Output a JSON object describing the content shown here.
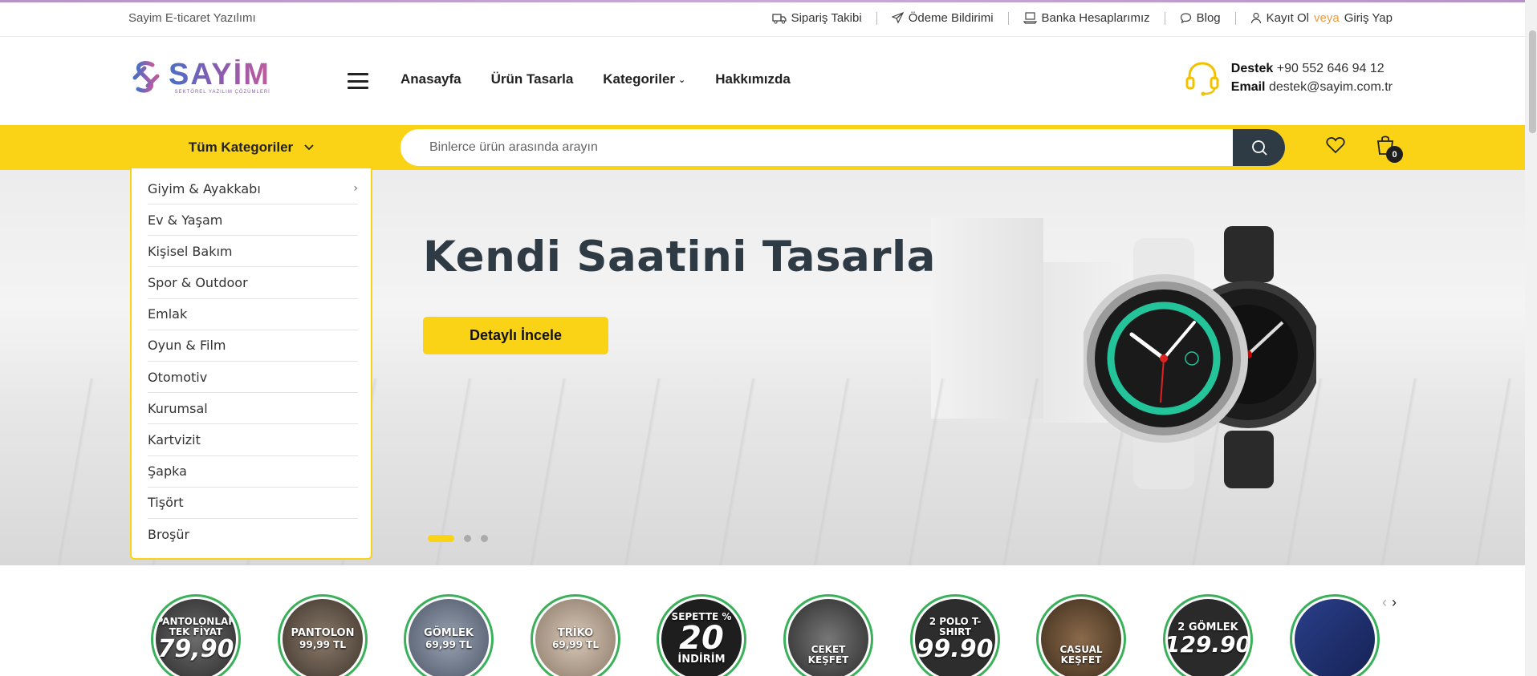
{
  "topbar": {
    "brand_text": "Sayim E-ticaret Yazılımı",
    "links": [
      {
        "label": "Sipariş Takibi",
        "icon": "truck-icon"
      },
      {
        "label": "Ödeme Bildirimi",
        "icon": "paper-plane-icon"
      },
      {
        "label": "Banka Hesaplarımız",
        "icon": "laptop-icon"
      },
      {
        "label": "Blog",
        "icon": "chat-bubble-icon"
      }
    ],
    "account": {
      "register": "Kayıt Ol",
      "or": "veya",
      "login": "Giriş Yap",
      "icon": "user-icon"
    }
  },
  "header": {
    "logo_name": "SAYİM",
    "logo_sub": "SEKTÖREL YAZILIM ÇÖZÜMLERİ",
    "nav": [
      "Anasayfa",
      "Ürün Tasarla",
      "Kategoriler",
      "Hakkımızda"
    ],
    "support": {
      "phone_label": "Destek",
      "phone": "+90 552 646 94 12",
      "email_label": "Email",
      "email": "destek@sayim.com.tr"
    }
  },
  "searchbar": {
    "all_categories": "Tüm Kategoriler",
    "placeholder": "Binlerce ürün arasında arayın",
    "cart_count": "0"
  },
  "categories": [
    "Giyim & Ayakkabı",
    "Ev & Yaşam",
    "Kişisel Bakım",
    "Spor & Outdoor",
    "Emlak",
    "Oyun & Film",
    "Otomotiv",
    "Kurumsal",
    "Kartvizit",
    "Şapka",
    "Tişört",
    "Broşür"
  ],
  "hero": {
    "title": "Kendi Saatini Tasarla",
    "button": "Detaylı İncele",
    "slide_count": 3,
    "active_slide": 1
  },
  "stories": [
    {
      "l1": "PANTOLONLAR",
      "l2": "TEK FİYAT",
      "big": "79,90"
    },
    {
      "l1": "PANTOLON",
      "l2": "99,99 TL",
      "big": ""
    },
    {
      "l1": "GÖMLEK",
      "l2": "69,99 TL",
      "big": ""
    },
    {
      "l1": "TRİKO",
      "l2": "69,99 TL",
      "big": ""
    },
    {
      "l1": "SEPETTE %",
      "l2": "İNDİRİM",
      "big": "20"
    },
    {
      "l1": "CEKET",
      "l2": "KEŞFET",
      "big": ""
    },
    {
      "l1": "2 POLO T-SHIRT",
      "l2": "",
      "big": "99.90"
    },
    {
      "l1": "CASUAL",
      "l2": "KEŞFET",
      "big": ""
    },
    {
      "l1": "2 GÖMLEK",
      "l2": "",
      "big": "129.90"
    },
    {
      "l1": "",
      "l2": "",
      "big": ""
    }
  ],
  "colors": {
    "accent": "#fad316",
    "dark": "#2e3a44",
    "story_ring": "#3ab05a"
  }
}
